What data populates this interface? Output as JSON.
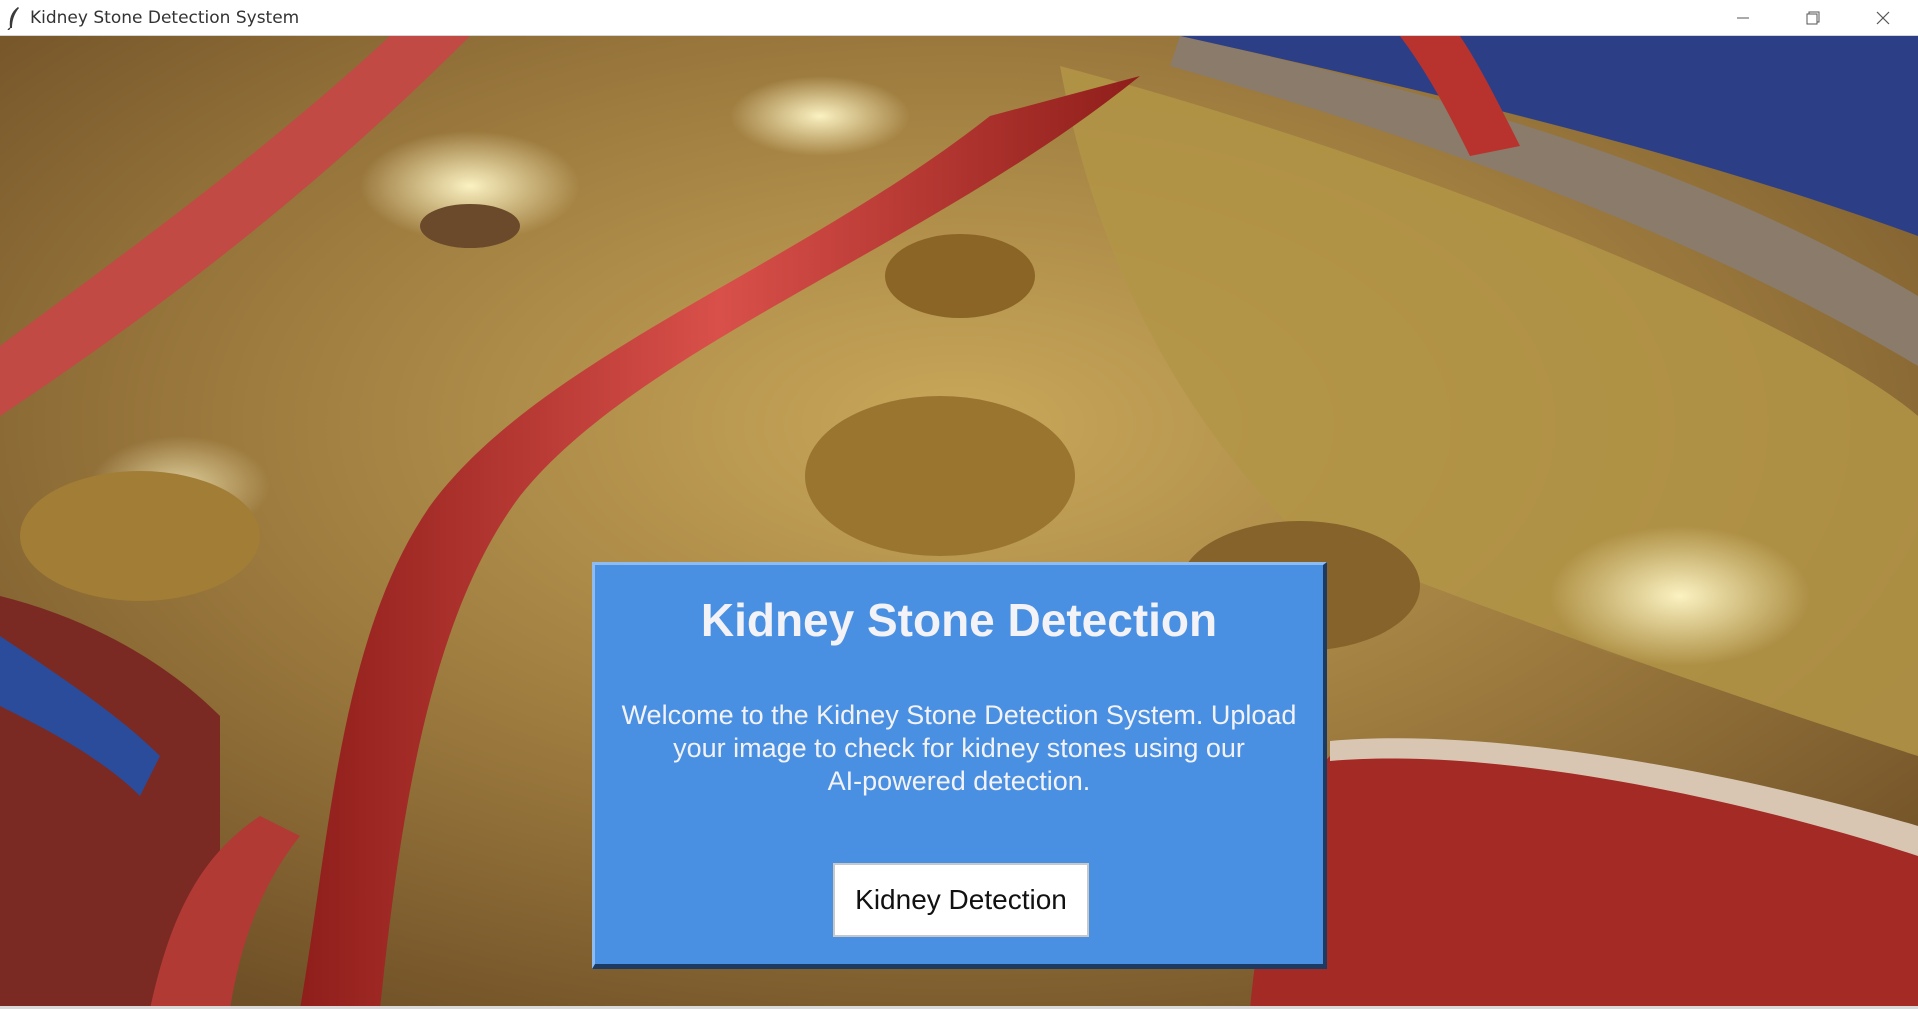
{
  "window": {
    "title": "Kidney Stone Detection System",
    "app_icon": "feather-icon",
    "controls": [
      "minimize-icon",
      "restore-icon",
      "close-icon"
    ]
  },
  "background": {
    "description_icon": "kidney-stone-illustration"
  },
  "panel": {
    "title": "Kidney Stone Detection",
    "description_lines": [
      "Welcome to the Kidney Stone Detection System. Upload",
      "your image to check for kidney stones using our",
      "AI-powered detection."
    ],
    "button_label": "Kidney Detection"
  },
  "colors": {
    "panel_bg": "#4a90e2",
    "panel_text": "#f2f2f7",
    "button_bg": "#ffffff"
  }
}
